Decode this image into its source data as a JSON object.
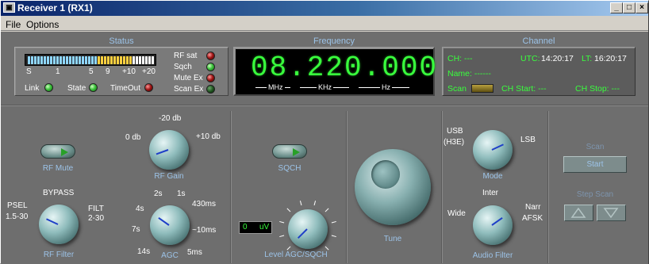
{
  "window": {
    "title": "Receiver 1  (RX1)",
    "icon": "receiver-icon",
    "buttons": [
      "_",
      "□",
      "×"
    ]
  },
  "menu": {
    "items": [
      "File",
      "Options"
    ]
  },
  "status": {
    "header": "Status",
    "meter_scale": [
      "S",
      "1",
      "5",
      "9",
      "+10",
      "+20"
    ],
    "indicators": [
      {
        "label": "RF sat",
        "state": "red"
      },
      {
        "label": "Sqch",
        "state": "green"
      },
      {
        "label": "Mute Ex",
        "state": "red"
      },
      {
        "label": "Scan Ex",
        "state": "dark-green"
      }
    ],
    "link": {
      "label": "Link",
      "state": "green"
    },
    "state": {
      "label": "State",
      "state": "green"
    },
    "timeout": {
      "label": "TimeOut",
      "state": "red"
    }
  },
  "frequency": {
    "header": "Frequency",
    "value": "08.220.000",
    "units": [
      "MHz",
      "KHz",
      "Hz"
    ]
  },
  "channel": {
    "header": "Channel",
    "ch": "CH: ---",
    "name": "Name: ------",
    "utc_label": "UTC:",
    "utc": "14:20:17",
    "lt_label": "LT:",
    "lt": "16:20:17",
    "scan": "Scan",
    "ch_start": "CH Start: ---",
    "ch_stop": "CH Stop: ---"
  },
  "controls": {
    "rf_mute": "RF Mute",
    "rf_gain": {
      "caption": "RF Gain",
      "labels": [
        "-20 db",
        "0 db",
        "+10 db"
      ],
      "level": 0.3
    },
    "rf_filter": {
      "caption": "RF Filter",
      "labels": [
        "BYPASS",
        "PSEL",
        "1.5-30",
        "FILT",
        "2-30"
      ]
    },
    "agc": {
      "caption": "AGC",
      "labels": [
        "2s",
        "1s",
        "4s",
        "430ms",
        "7s",
        "~10ms",
        "14s",
        "5ms"
      ]
    },
    "sqch": "SQCH",
    "level_agc": {
      "caption": "Level AGC/SQCH",
      "value": "0",
      "unit": "uV"
    },
    "tune": "Tune",
    "mode": {
      "caption": "Mode",
      "labels": [
        "USB",
        "(H3E)",
        "LSB"
      ]
    },
    "audio_filter": {
      "caption": "Audio Filter",
      "labels": [
        "Inter",
        "Wide",
        "Narr",
        "AFSK"
      ]
    },
    "scan": {
      "label": "Scan",
      "start": "Start",
      "step_scan": "Step Scan"
    }
  },
  "colors": {
    "accent_text": "#9cc3e8",
    "lcd_green": "#39ff3d",
    "panel": "#6e6e6e"
  }
}
